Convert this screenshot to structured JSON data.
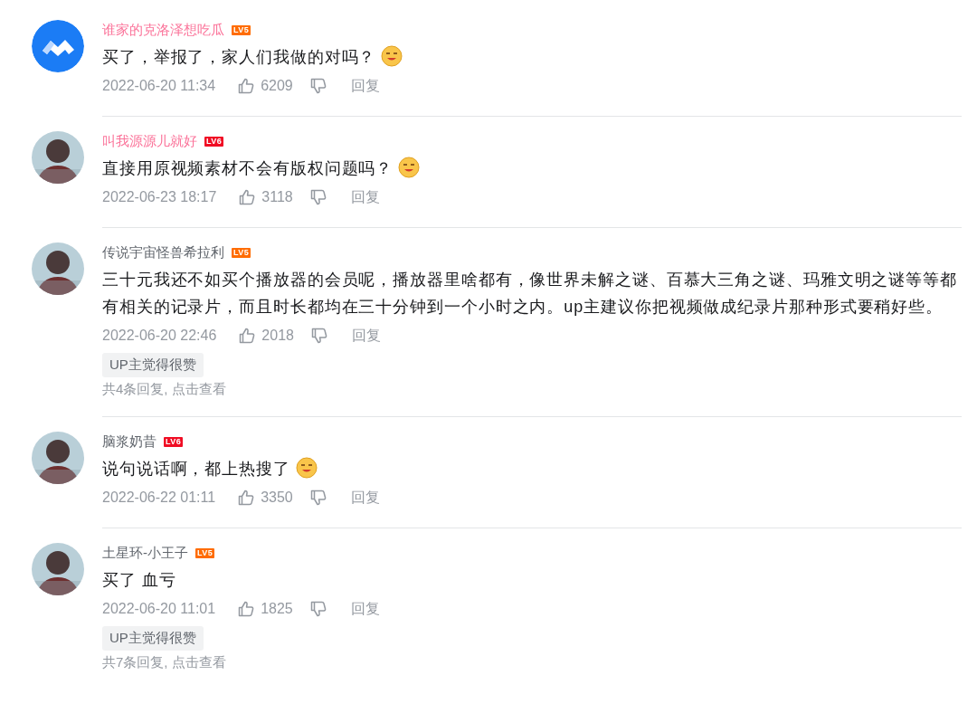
{
  "comments": [
    {
      "avatar": {
        "kind": "logo"
      },
      "user": "谁家的克洛泽想吃瓜",
      "vip": true,
      "level": "LV5",
      "color": "#ff6c00",
      "text": "买了，举报了，家人们我做的对吗？",
      "sticker": true,
      "time": "2022-06-20 11:34",
      "likes": "6209",
      "reply": "回复"
    },
    {
      "user": "叫我源源儿就好",
      "vip": true,
      "level": "LV6",
      "color": "#f00d24",
      "text": "直接用原视频素材不会有版权问题吗？",
      "sticker": true,
      "time": "2022-06-23 18:17",
      "likes": "3118",
      "reply": "回复"
    },
    {
      "user": "传说宇宙怪兽希拉利",
      "vip": false,
      "level": "LV5",
      "color": "#ff6c00",
      "text": "三十元我还不如买个播放器的会员呢，播放器里啥都有，像世界未解之谜、百慕大三角之谜、玛雅文明之谜等等都有相关的记录片，而且时长都均在三十分钟到一个小时之内。up主建议你把视频做成纪录片那种形式要稍好些。",
      "sticker": false,
      "time": "2022-06-20 22:46",
      "likes": "2018",
      "reply": "回复",
      "tag": "UP主觉得很赞",
      "replies": "共4条回复, 点击查看"
    },
    {
      "user": "脑浆奶昔",
      "vip": false,
      "level": "LV6",
      "color": "#f00d24",
      "text": "说句说话啊，都上热搜了",
      "sticker": true,
      "time": "2022-06-22 01:11",
      "likes": "3350",
      "reply": "回复"
    },
    {
      "user": "土星环-小王子",
      "vip": false,
      "level": "LV5",
      "color": "#ff6c00",
      "text": "买了 血亏",
      "sticker": false,
      "time": "2022-06-20 11:01",
      "likes": "1825",
      "reply": "回复",
      "tag": "UP主觉得很赞",
      "replies": "共7条回复, 点击查看"
    }
  ]
}
